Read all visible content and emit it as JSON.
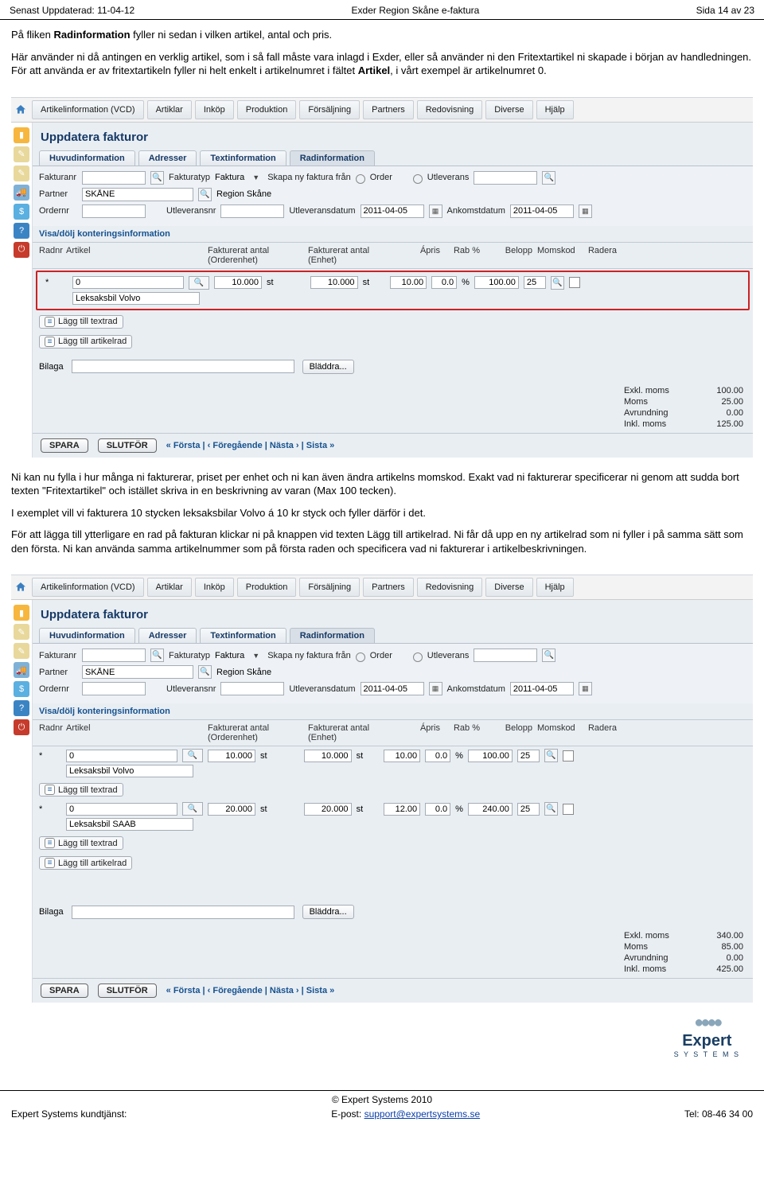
{
  "header": {
    "left": "Senast Uppdaterad: 11-04-12",
    "center": "Exder Region Skåne e-faktura",
    "right": "Sida 14 av 23"
  },
  "paragraphs": {
    "p1a": "På fliken ",
    "p1b": "Radinformation",
    "p1c": " fyller ni sedan i vilken artikel, antal och pris.",
    "p2a": "Här använder ni då antingen en verklig artikel, som i så fall måste vara inlagd i Exder, eller så använder ni den Fritextartikel ni skapade i början av handledningen. För att använda er av fritextartikeln fyller ni helt enkelt i artikelnumret i fältet ",
    "p2b": "Artikel",
    "p2c": ", i vårt exempel är artikelnumret 0.",
    "p3": "Ni kan nu fylla i hur många ni fakturerar, priset per enhet och ni kan även ändra artikelns momskod. Exakt vad ni fakturerar specificerar ni genom att sudda bort texten \"Fritextartikel\" och istället skriva in en beskrivning av varan (Max 100 tecken).",
    "p4": "I exemplet vill vi fakturera 10 stycken leksaksbilar Volvo á 10 kr styck och fyller därför i det.",
    "p5": "För att lägga till ytterligare en rad på fakturan klickar ni på knappen vid texten Lägg till artikelrad. Ni får då upp en ny artikelrad som ni fyller i på samma sätt som den första. Ni kan använda samma artikelnummer som på första raden och specificera vad ni fakturerar i artikelbeskrivningen."
  },
  "app": {
    "menu": [
      "Artikelinformation (VCD)",
      "Artiklar",
      "Inköp",
      "Produktion",
      "Försäljning",
      "Partners",
      "Redovisning",
      "Diverse",
      "Hjälp"
    ],
    "title": "Uppdatera fakturor",
    "tabs": [
      "Huvudinformation",
      "Adresser",
      "Textinformation",
      "Radinformation"
    ],
    "labels": {
      "fakturanr": "Fakturanr",
      "fakturatyp": "Fakturatyp",
      "fakturatyp_val": "Faktura",
      "skapa_ny": "Skapa ny faktura från",
      "order": "Order",
      "utleverans": "Utleverans",
      "partner": "Partner",
      "partner_val": "SKÅNE",
      "region": "Region Skåne",
      "ordernr": "Ordernr",
      "utleveransnr": "Utleveransnr",
      "utleveransdatum": "Utleveransdatum",
      "date": "2011-04-05",
      "ankomstdatum": "Ankomstdatum",
      "visa_dolj": "Visa/dölj konteringsinformation"
    },
    "grid_headers": {
      "radnr": "Radnr",
      "artikel": "Artikel",
      "fa1": "Fakturerat antal (Orderenhet)",
      "fa2": "Fakturerat antal (Enhet)",
      "apris": "Ápris",
      "rab": "Rab %",
      "belopp": "Belopp",
      "momskod": "Momskod",
      "radera": "Radera"
    },
    "row1": {
      "radnr": "*",
      "artikel": "0",
      "antal1": "10.000",
      "unit": "st",
      "antal2": "10.000",
      "apris": "10.00",
      "rab": "0.0",
      "rabu": "%",
      "belopp": "100.00",
      "moms": "25",
      "desc": "Leksaksbil Volvo"
    },
    "row2": {
      "radnr": "*",
      "artikel": "0",
      "antal1": "20.000",
      "unit": "st",
      "antal2": "20.000",
      "apris": "12.00",
      "rab": "0.0",
      "rabu": "%",
      "belopp": "240.00",
      "moms": "25",
      "desc": "Leksaksbil SAAB"
    },
    "add_textrow": "Lägg till textrad",
    "add_row": "Lägg till artikelrad",
    "bilaga": "Bilaga",
    "bladdra": "Bläddra...",
    "totals1": {
      "exkl": "Exkl. moms",
      "exkl_v": "100.00",
      "moms": "Moms",
      "moms_v": "25.00",
      "avr": "Avrundning",
      "avr_v": "0.00",
      "inkl": "Inkl. moms",
      "inkl_v": "125.00"
    },
    "totals2": {
      "exkl": "Exkl. moms",
      "exkl_v": "340.00",
      "moms": "Moms",
      "moms_v": "85.00",
      "avr": "Avrundning",
      "avr_v": "0.00",
      "inkl": "Inkl. moms",
      "inkl_v": "425.00"
    },
    "spara": "SPARA",
    "slutfor": "SLUTFÖR",
    "nav": "« Första  |  ‹ Föregående  |  Nästa ›  |  Sista »"
  },
  "footer": {
    "copyright": "© Expert Systems 2010",
    "left": "Expert Systems kundtjänst:",
    "midlabel": "E-post: ",
    "mail": "support@expertsystems.se",
    "right": "Tel: 08-46 34 00",
    "logo_word": "Expert",
    "logo_sub": "S Y S T E M S"
  }
}
